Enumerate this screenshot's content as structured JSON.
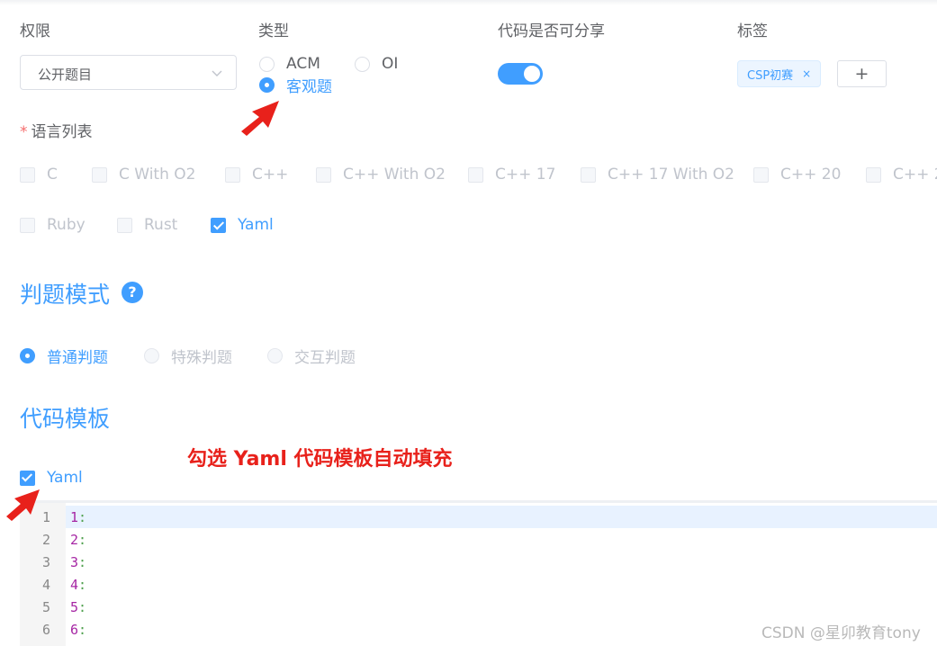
{
  "fields": {
    "permission_label": "权限",
    "type_label": "类型",
    "share_label": "代码是否可分享",
    "tags_label": "标签"
  },
  "permission_select": {
    "value": "公开题目"
  },
  "type_radios": [
    {
      "label": "ACM",
      "checked": false
    },
    {
      "label": "OI",
      "checked": false
    },
    {
      "label": "客观题",
      "checked": true
    }
  ],
  "share_switch": {
    "on": true
  },
  "tags": [
    {
      "label": "CSP初赛",
      "close": "×"
    }
  ],
  "add_tag_button": "+",
  "languages": {
    "label": "语言列表",
    "required_mark": "*",
    "row1": [
      "C",
      "C With O2",
      "C++",
      "C++ With O2",
      "C++ 17",
      "C++ 17 With O2",
      "C++ 20",
      "C++ 2"
    ],
    "row2": [
      "Ruby",
      "Rust",
      "Yaml"
    ],
    "checked": [
      "Yaml"
    ]
  },
  "judge_mode": {
    "title": "判题模式",
    "help": "?",
    "options": [
      {
        "label": "普通判题",
        "checked": true
      },
      {
        "label": "特殊判题",
        "checked": false
      },
      {
        "label": "交互判题",
        "checked": false
      }
    ]
  },
  "code_template": {
    "title": "代码模板",
    "checkbox_label": "Yaml",
    "lines": [
      {
        "num": "1",
        "key": "1",
        "colon": ":"
      },
      {
        "num": "2",
        "key": "2",
        "colon": ":"
      },
      {
        "num": "3",
        "key": "3",
        "colon": ":"
      },
      {
        "num": "4",
        "key": "4",
        "colon": ":"
      },
      {
        "num": "5",
        "key": "5",
        "colon": ":"
      },
      {
        "num": "6",
        "key": "6",
        "colon": ":"
      }
    ]
  },
  "annotation": "勾选 Yaml 代码模板自动填充",
  "watermark": "CSDN @星卯教育tony",
  "colors": {
    "primary": "#409eff",
    "annotation": "#e8211b",
    "required": "#f56c6c"
  }
}
